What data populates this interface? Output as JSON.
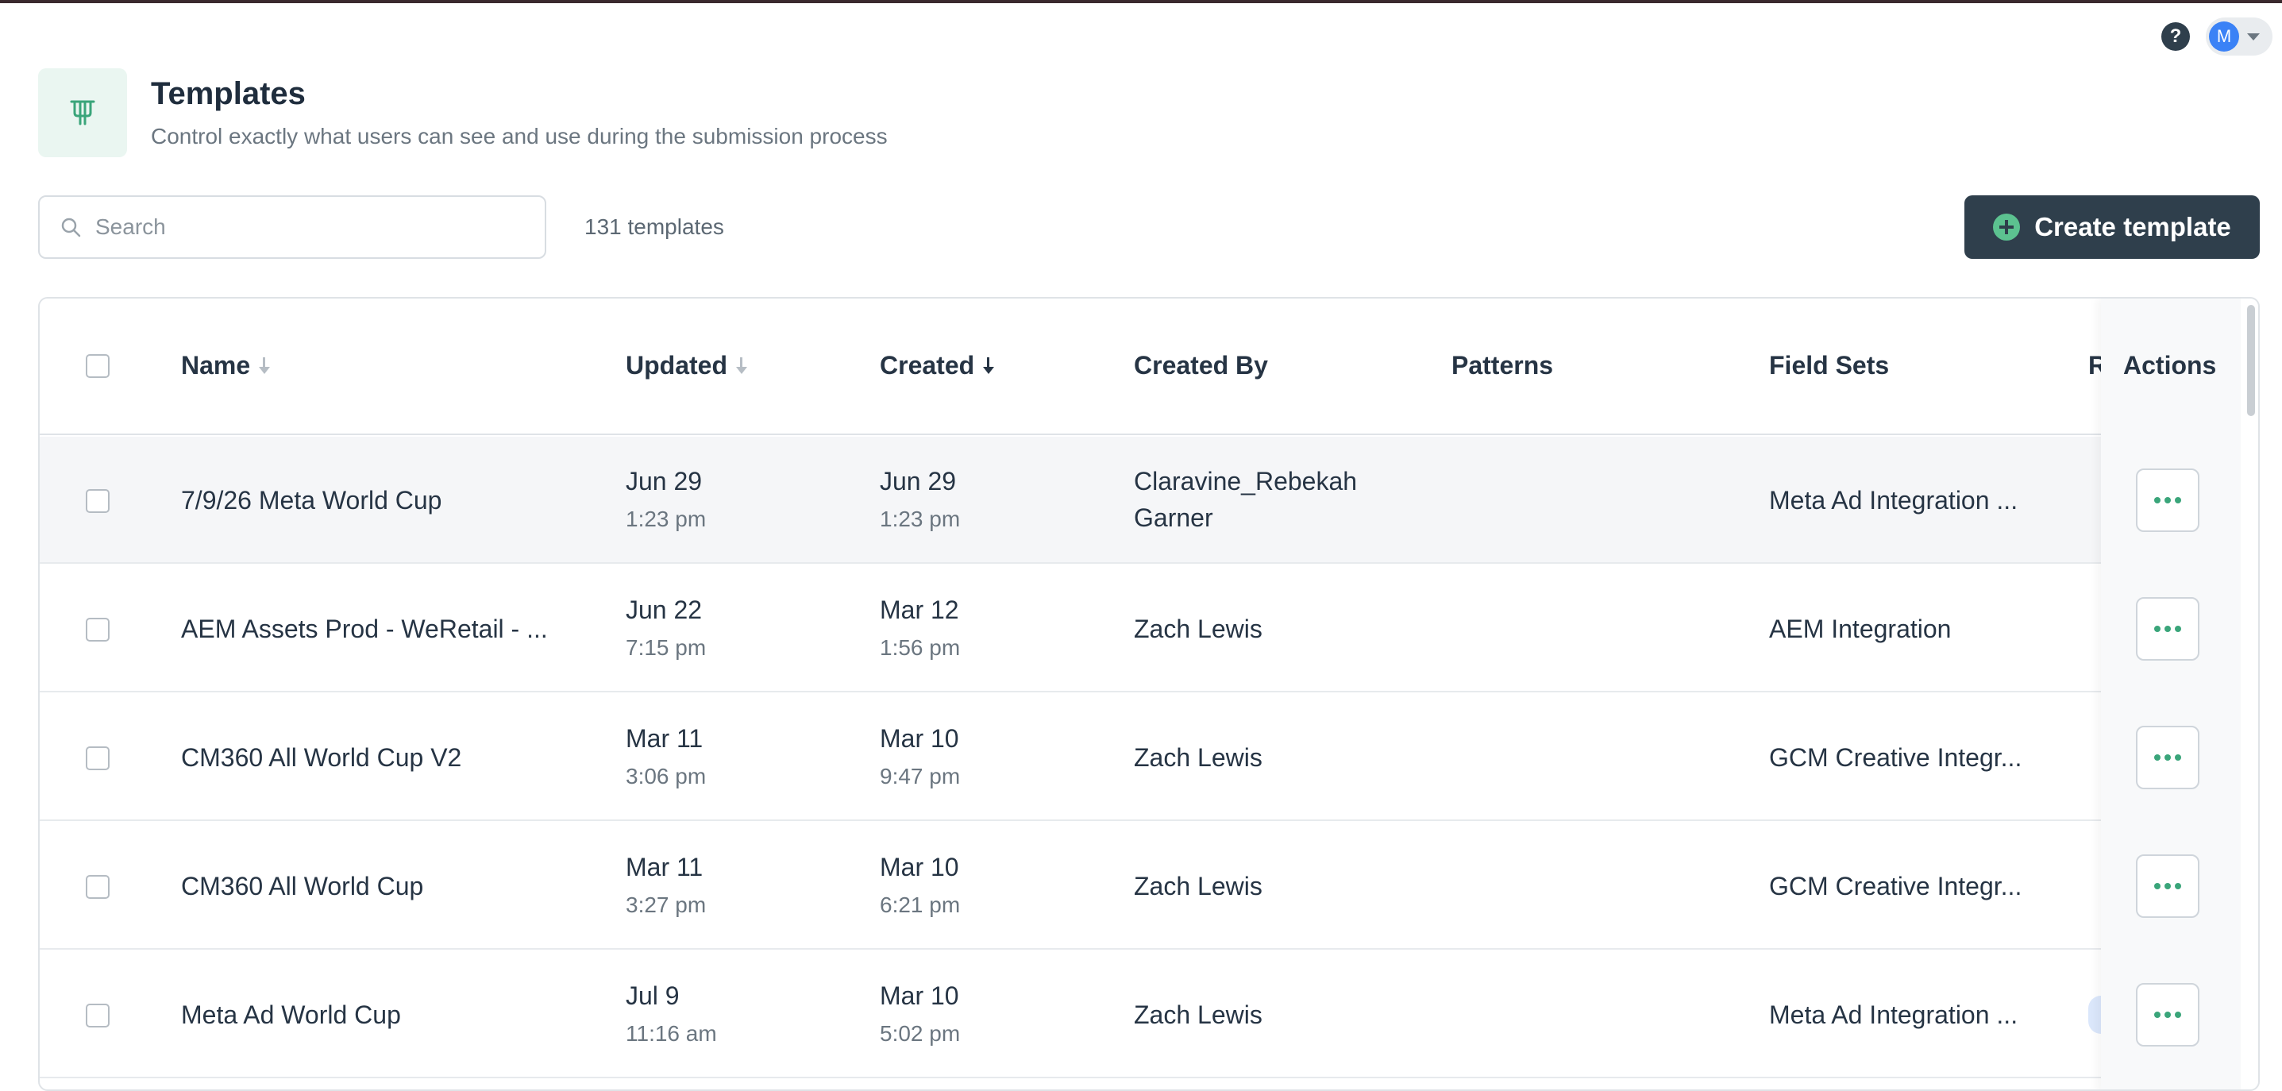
{
  "header": {
    "title": "Templates",
    "subtitle": "Control exactly what users can see and use during the submission process",
    "icon": "template-icon"
  },
  "user": {
    "avatar_initial": "M",
    "help_icon": "?"
  },
  "toolbar": {
    "search_placeholder": "Search",
    "count": "131 templates",
    "create_label": "Create template"
  },
  "colors": {
    "primary": "#2f3f4c",
    "accent": "#5cc290",
    "dots": "#3aa57a"
  },
  "table": {
    "columns": {
      "name": "Name",
      "updated": "Updated",
      "created": "Created",
      "created_by": "Created By",
      "patterns": "Patterns",
      "field_sets": "Field Sets",
      "cut": "R",
      "actions": "Actions"
    },
    "rows": [
      {
        "name": "7/9/26 Meta World Cup",
        "updated_date": "Jun 29",
        "updated_time": "1:23 pm",
        "created_date": "Jun 29",
        "created_time": "1:23 pm",
        "created_by_1": "Claravine_Rebekah",
        "created_by_2": "Garner",
        "patterns": "",
        "field_sets": "Meta Ad Integration ..."
      },
      {
        "name": "AEM Assets Prod - WeRetail - ...",
        "updated_date": "Jun 22",
        "updated_time": "7:15 pm",
        "created_date": "Mar 12",
        "created_time": "1:56 pm",
        "created_by_1": "Zach Lewis",
        "created_by_2": "",
        "patterns": "",
        "field_sets": "AEM Integration"
      },
      {
        "name": "CM360 All World Cup V2",
        "updated_date": "Mar 11",
        "updated_time": "3:06 pm",
        "created_date": "Mar 10",
        "created_time": "9:47 pm",
        "created_by_1": "Zach Lewis",
        "created_by_2": "",
        "patterns": "",
        "field_sets": "GCM Creative Integr..."
      },
      {
        "name": "CM360 All World Cup",
        "updated_date": "Mar 11",
        "updated_time": "3:27 pm",
        "created_date": "Mar 10",
        "created_time": "6:21 pm",
        "created_by_1": "Zach Lewis",
        "created_by_2": "",
        "patterns": "",
        "field_sets": "GCM Creative Integr..."
      },
      {
        "name": "Meta Ad World Cup",
        "updated_date": "Jul 9",
        "updated_time": "11:16 am",
        "created_date": "Mar 10",
        "created_time": "5:02 pm",
        "created_by_1": "Zach Lewis",
        "created_by_2": "",
        "patterns": "",
        "field_sets": "Meta Ad Integration ..."
      }
    ]
  }
}
